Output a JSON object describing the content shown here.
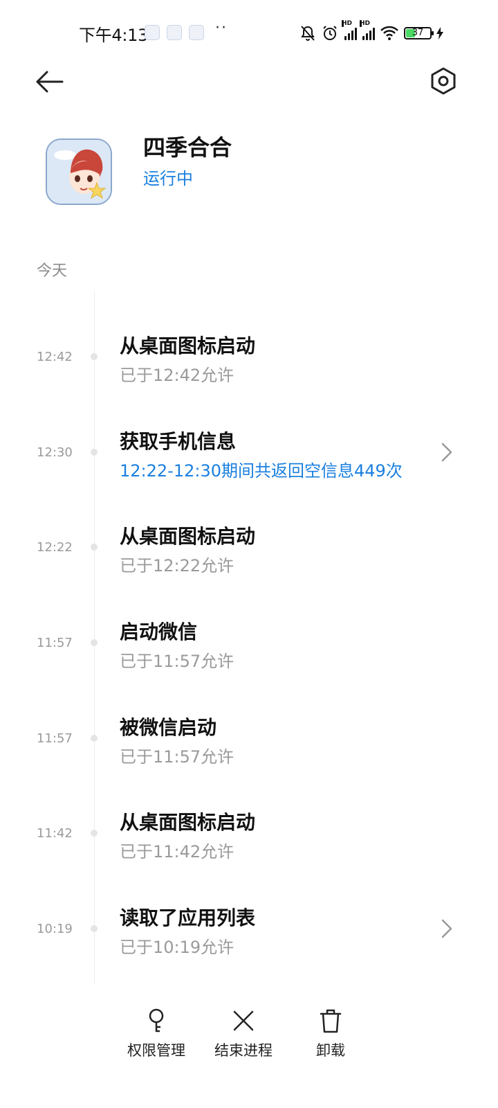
{
  "status_bar": {
    "time": "下午4:13",
    "dots": "··",
    "battery_level": "37",
    "signal_label": "HD"
  },
  "header": {
    "back_icon": "arrow-left-icon",
    "settings_icon": "hexagon-gear-icon"
  },
  "app": {
    "name": "四季合合",
    "status": "运行中",
    "status_color": "#1a7fe0"
  },
  "section_label": "今天",
  "timeline": [
    {
      "time": "12:42",
      "title": "从桌面图标启动",
      "subtitle": "已于12:42允许",
      "highlight": false,
      "has_chevron": false
    },
    {
      "time": "12:30",
      "title": "获取手机信息",
      "subtitle": "12:22-12:30期间共返回空信息449次",
      "highlight": true,
      "has_chevron": true
    },
    {
      "time": "12:22",
      "title": "从桌面图标启动",
      "subtitle": "已于12:22允许",
      "highlight": false,
      "has_chevron": false
    },
    {
      "time": "11:57",
      "title": "启动微信",
      "subtitle": "已于11:57允许",
      "highlight": false,
      "has_chevron": false
    },
    {
      "time": "11:57",
      "title": "被微信启动",
      "subtitle": "已于11:57允许",
      "highlight": false,
      "has_chevron": false
    },
    {
      "time": "11:42",
      "title": "从桌面图标启动",
      "subtitle": "已于11:42允许",
      "highlight": false,
      "has_chevron": false
    },
    {
      "time": "10:19",
      "title": "读取了应用列表",
      "subtitle": "已于10:19允许",
      "highlight": false,
      "has_chevron": true
    }
  ],
  "bottom_bar": {
    "permissions_label": "权限管理",
    "end_process_label": "结束进程",
    "uninstall_label": "卸载"
  }
}
